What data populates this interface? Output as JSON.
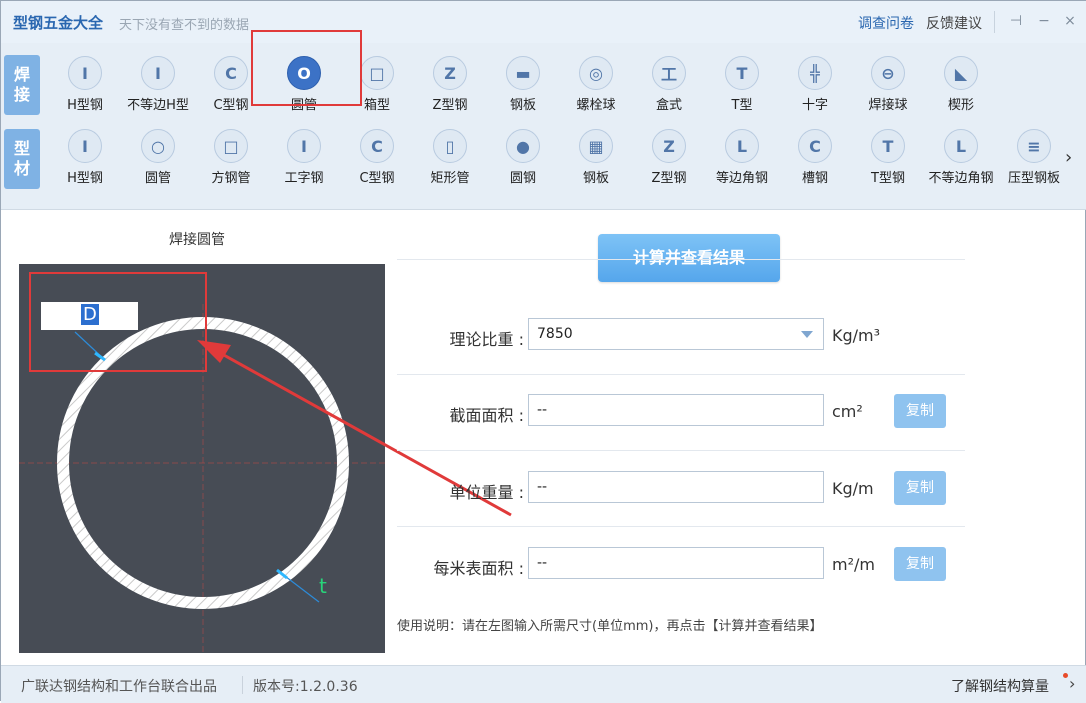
{
  "window": {
    "title": "型钢五金大全",
    "subtitle": "天下没有查不到的数据",
    "survey": "调查问卷",
    "feedback": "反馈建议",
    "pin": "⊣",
    "minimize": "−",
    "close": "×"
  },
  "categories": {
    "weld": "焊接",
    "profile": "型材"
  },
  "weld_tools": [
    {
      "label": "H型钢",
      "glyph": "I"
    },
    {
      "label": "不等边H型",
      "glyph": "I"
    },
    {
      "label": "C型钢",
      "glyph": "C"
    },
    {
      "label": "圆管",
      "glyph": "O"
    },
    {
      "label": "箱型",
      "glyph": "□"
    },
    {
      "label": "Z型钢",
      "glyph": "Z"
    },
    {
      "label": "钢板",
      "glyph": "▬"
    },
    {
      "label": "螺栓球",
      "glyph": "◎"
    },
    {
      "label": "盒式",
      "glyph": "工"
    },
    {
      "label": "T型",
      "glyph": "T"
    },
    {
      "label": "十字",
      "glyph": "╬"
    },
    {
      "label": "焊接球",
      "glyph": "⊖"
    },
    {
      "label": "楔形",
      "glyph": "◣"
    }
  ],
  "profile_tools": [
    {
      "label": "H型钢",
      "glyph": "I"
    },
    {
      "label": "圆管",
      "glyph": "○"
    },
    {
      "label": "方钢管",
      "glyph": "□"
    },
    {
      "label": "工字钢",
      "glyph": "I"
    },
    {
      "label": "C型钢",
      "glyph": "C"
    },
    {
      "label": "矩形管",
      "glyph": "▯"
    },
    {
      "label": "圆钢",
      "glyph": "●"
    },
    {
      "label": "钢板",
      "glyph": "▦"
    },
    {
      "label": "Z型钢",
      "glyph": "Z"
    },
    {
      "label": "等边角钢",
      "glyph": "L"
    },
    {
      "label": "槽钢",
      "glyph": "C"
    },
    {
      "label": "T型钢",
      "glyph": "T"
    },
    {
      "label": "不等边角钢",
      "glyph": "L"
    },
    {
      "label": "压型钢板",
      "glyph": "≡"
    }
  ],
  "more_arrow": "›",
  "diagram": {
    "title": "焊接圆管",
    "d_value": "D",
    "t_label": "t"
  },
  "calc_button": "计算并查看结果",
  "form": {
    "density_label": "理论比重 :",
    "density_value": "7850",
    "density_unit": "Kg/m³",
    "area_label": "截面面积 :",
    "area_value": "--",
    "area_unit": "cm²",
    "weight_label": "单位重量 :",
    "weight_value": "--",
    "weight_unit": "Kg/m",
    "surface_label": "每米表面积 :",
    "surface_value": "--",
    "surface_unit": "m²/m",
    "copy": "复制"
  },
  "hint": "使用说明：请在左图输入所需尺寸(单位mm)，再点击【计算并查看结果】",
  "footer": {
    "credit": "广联达钢结构和工作台联合出品",
    "version": "版本号:1.2.0.36",
    "learn": "了解钢结构算量",
    "learn_chevron": "›"
  },
  "colors": {
    "accent": "#2a67b0",
    "selected_icon": "#3c72c6",
    "annotation": "#e03a3a",
    "diagram_bg": "#474c55"
  }
}
